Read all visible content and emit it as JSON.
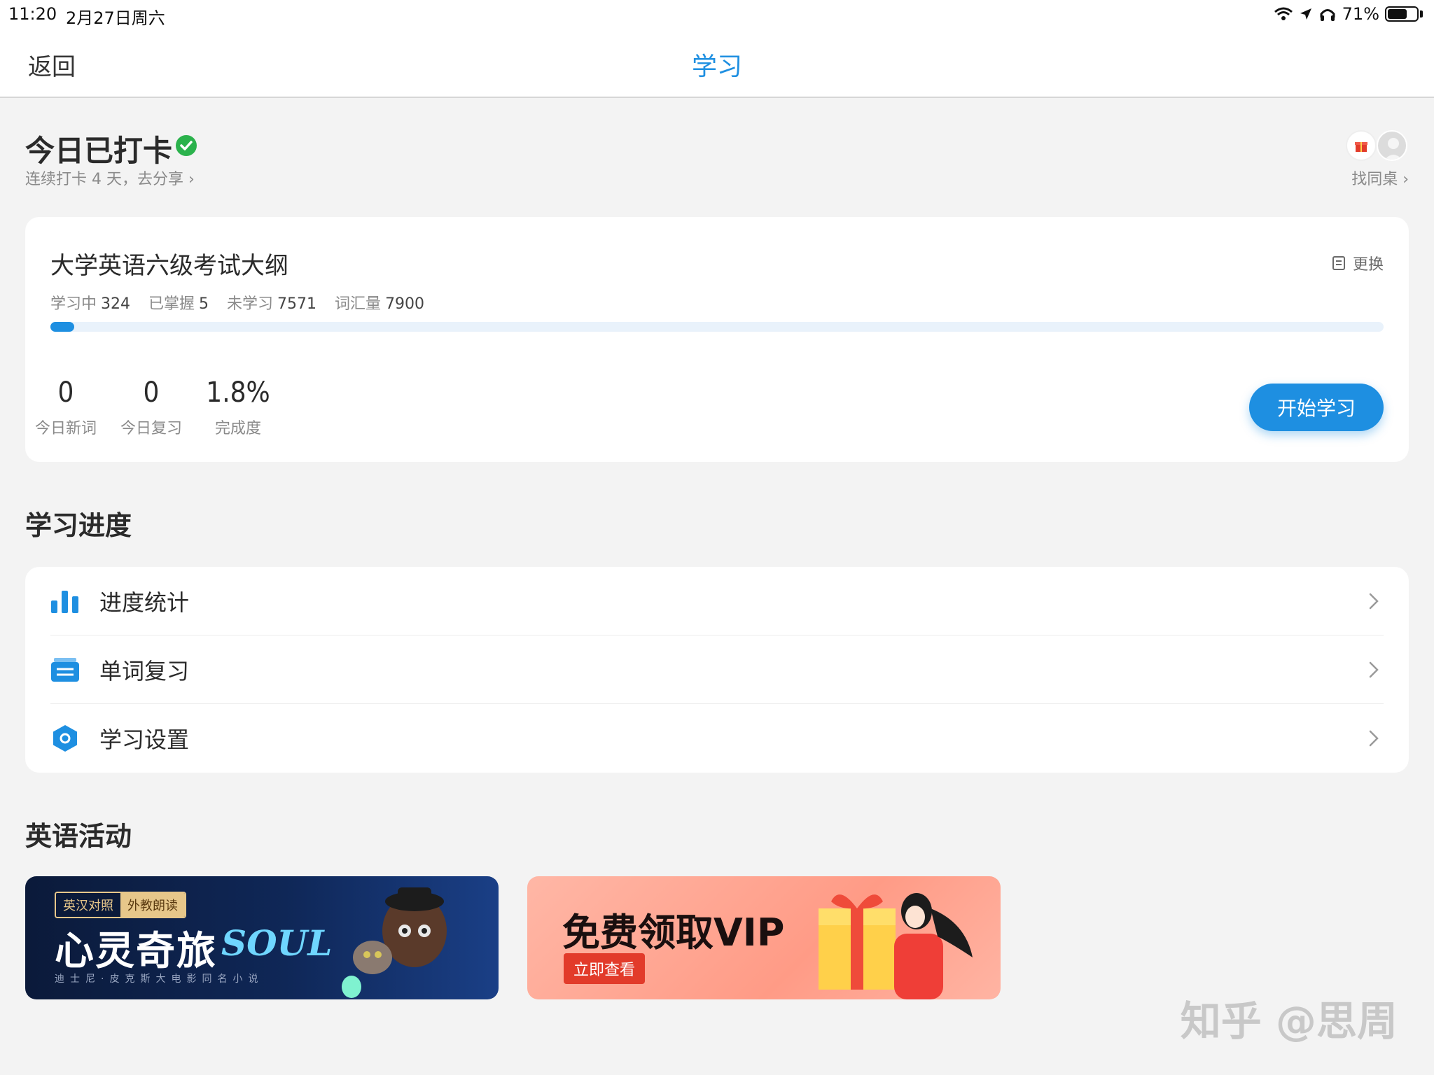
{
  "status_bar": {
    "time": "11:20",
    "date": "2月27日周六",
    "battery_percent": "71%",
    "battery_level": 0.71
  },
  "nav": {
    "back_label": "返回",
    "title": "学习"
  },
  "checkin": {
    "title": "今日已打卡",
    "subtitle": "连续打卡 4 天，去分享 ›",
    "find_desk_label": "找同桌 ›"
  },
  "book": {
    "title": "大学英语六级考试大纲",
    "change_label": "更换",
    "stats": [
      {
        "label": "学习中",
        "value": "324"
      },
      {
        "label": "已掌握",
        "value": "5"
      },
      {
        "label": "未学习",
        "value": "7571"
      },
      {
        "label": "词汇量",
        "value": "7900"
      }
    ],
    "progress_fraction": 0.018,
    "metrics": [
      {
        "value": "0",
        "label": "今日新词"
      },
      {
        "value": "0",
        "label": "今日复习"
      },
      {
        "value": "1.8%",
        "label": "完成度"
      }
    ],
    "start_label": "开始学习"
  },
  "progress_section": {
    "title": "学习进度",
    "items": [
      {
        "label": "进度统计",
        "icon": "bar-chart-icon"
      },
      {
        "label": "单词复习",
        "icon": "cards-icon"
      },
      {
        "label": "学习设置",
        "icon": "settings-hexagon-icon"
      }
    ]
  },
  "activity_section": {
    "title": "英语活动",
    "soul_banner": {
      "tag_a": "英汉对照",
      "tag_b": "外教朗读",
      "title": "心灵奇旅",
      "logo": "SOUL",
      "subtitle": "迪士尼·皮克斯大电影同名小说"
    },
    "vip_banner": {
      "title": "免费领取VIP",
      "button": "立即查看"
    }
  },
  "watermark": "知乎 @思周",
  "colors": {
    "accent": "#1e8fe1",
    "check_green": "#2bb24c",
    "background": "#f3f3f3"
  }
}
